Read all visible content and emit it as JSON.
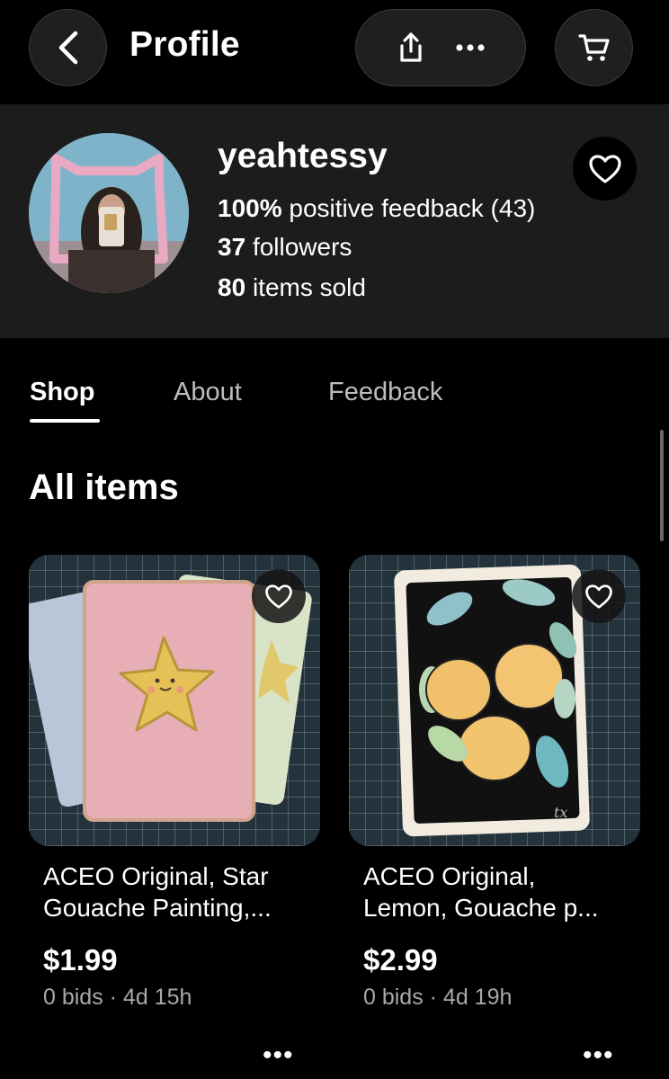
{
  "header": {
    "title": "Profile",
    "icons": {
      "back": "back-arrow-icon",
      "share": "share-icon",
      "more": "more-horizontal-icon",
      "cart": "cart-icon"
    }
  },
  "seller": {
    "username": "yeahtessy",
    "feedback_percent": "100%",
    "feedback_label": "positive feedback (43)",
    "followers_count": "37",
    "followers_label": "followers",
    "sold_count": "80",
    "sold_label": "items sold"
  },
  "tabs": [
    {
      "label": "Shop",
      "active": true
    },
    {
      "label": "About",
      "active": false
    },
    {
      "label": "Feedback",
      "active": false
    }
  ],
  "section_title": "All items",
  "listings": [
    {
      "title_line1": "ACEO Original, Star",
      "title_line2": "Gouache Painting,...",
      "price": "$1.99",
      "meta": "0 bids · 4d 15h",
      "more": "•••"
    },
    {
      "title_line1": "ACEO Original,",
      "title_line2": "Lemon, Gouache p...",
      "price": "$2.99",
      "meta": "0 bids · 4d 19h",
      "more": "•••"
    }
  ],
  "colors": {
    "background": "#000000",
    "card_bg": "#1c1c1c",
    "muted_text": "#a8a8a8"
  }
}
